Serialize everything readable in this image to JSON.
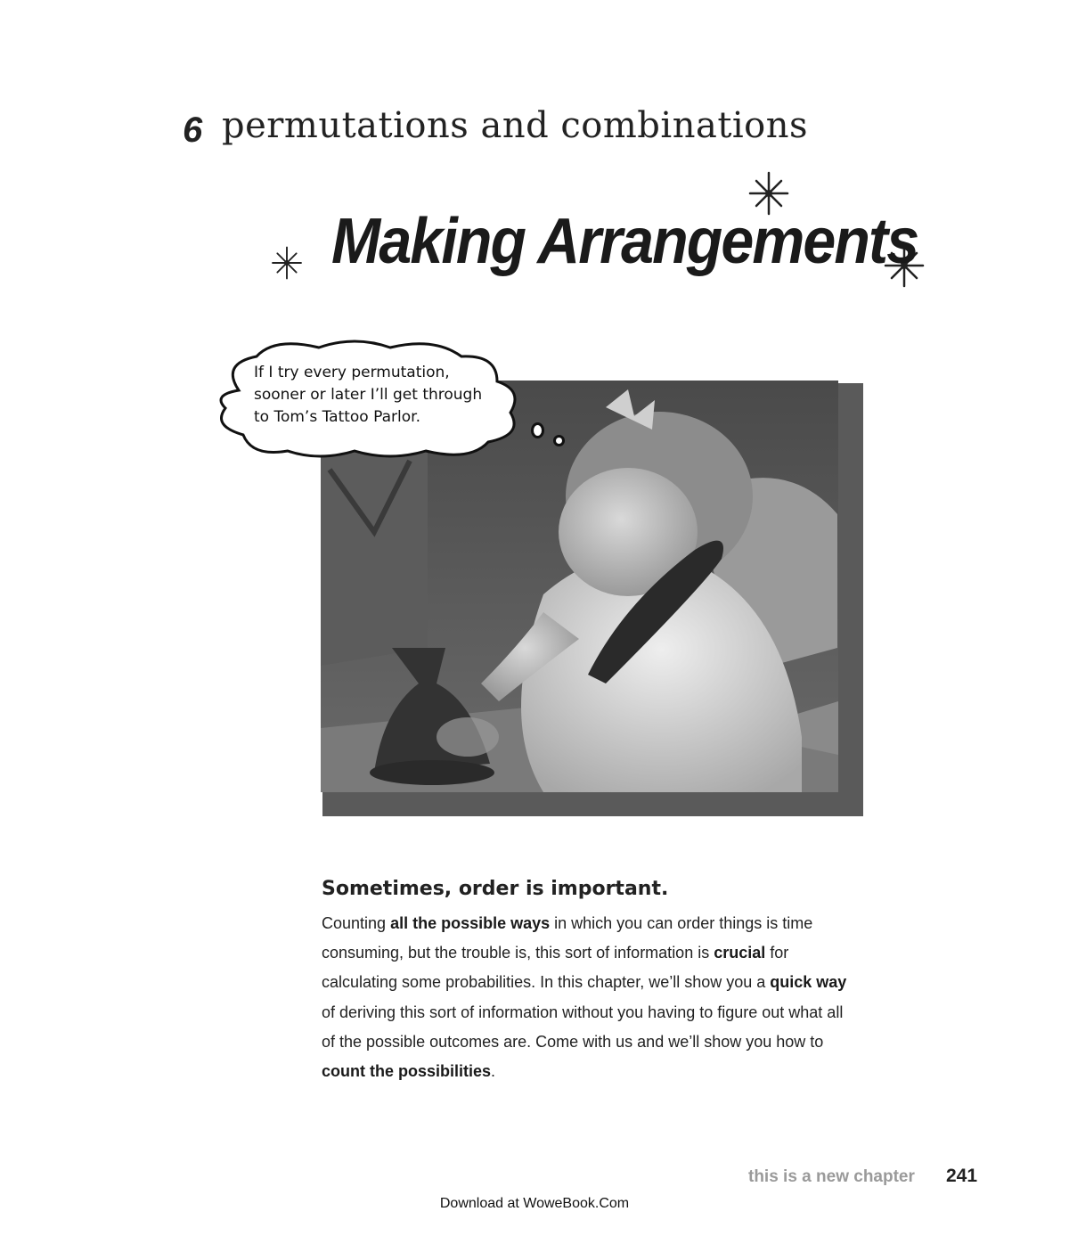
{
  "chapter": {
    "number": "6",
    "name": "permutations and combinations",
    "title": "Making Arrangements"
  },
  "thought_bubble": {
    "lines": [
      "If I try every permutation,",
      "sooner or later I’ll get through",
      "to Tom’s Tattoo Parlor."
    ]
  },
  "section": {
    "heading": "Sometimes, order is important.",
    "paragraph_lines": [
      [
        {
          "t": "Counting "
        },
        {
          "t": "all the possible ways",
          "b": true
        },
        {
          "t": " in which you can order things is time"
        }
      ],
      [
        {
          "t": "consuming, but the trouble is, this sort of information is "
        },
        {
          "t": "crucial",
          "b": true
        },
        {
          "t": " for"
        }
      ],
      [
        {
          "t": "calculating some probabilities. In this chapter, we’ll show you a "
        },
        {
          "t": "quick way",
          "b": true
        }
      ],
      [
        {
          "t": "of deriving this sort of information without you having to figure out what all"
        }
      ],
      [
        {
          "t": "of the possible outcomes are. Come with us and we’ll show you how to"
        }
      ],
      [
        {
          "t": "count the possibilities",
          "b": true
        },
        {
          "t": "."
        }
      ]
    ]
  },
  "footer": {
    "label": "this is a new chapter",
    "page_number": "241",
    "download_note": "Download at WoweBook.Com"
  },
  "colors": {
    "text": "#222222",
    "footer_label": "#9a9a9a",
    "photo_shadow": "#5a5a5a"
  }
}
